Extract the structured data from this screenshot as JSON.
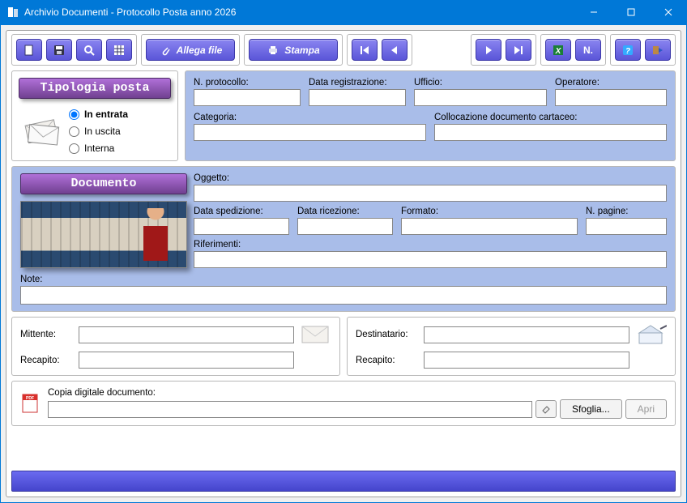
{
  "window": {
    "title": "Archivio Documenti - Protocollo Posta anno 2026"
  },
  "toolbar": {
    "new_icon": "new-file",
    "save_icon": "save",
    "search_icon": "search",
    "grid_icon": "grid",
    "attach_label": "Allega file",
    "print_label": "Stampa",
    "nav_first": "first",
    "nav_prev": "prev",
    "nav_next": "next",
    "nav_last": "last",
    "excel_icon": "excel",
    "n_label": "N.",
    "help_icon": "help",
    "exit_icon": "exit"
  },
  "type_panel": {
    "title": "Tipologia posta",
    "options": {
      "in_entrata": "In entrata",
      "in_uscita": "In uscita",
      "interna": "Interna"
    },
    "selected": "in_entrata"
  },
  "protocol": {
    "n_protocollo_label": "N. protocollo:",
    "n_protocollo": "",
    "data_registrazione_label": "Data registrazione:",
    "data_registrazione": "",
    "ufficio_label": "Ufficio:",
    "ufficio": "",
    "operatore_label": "Operatore:",
    "operatore": "",
    "categoria_label": "Categoria:",
    "categoria": "",
    "collocazione_label": "Collocazione documento cartaceo:",
    "collocazione": ""
  },
  "documento": {
    "title": "Documento",
    "oggetto_label": "Oggetto:",
    "oggetto": "",
    "data_spedizione_label": "Data spedizione:",
    "data_spedizione": "",
    "data_ricezione_label": "Data ricezione:",
    "data_ricezione": "",
    "formato_label": "Formato:",
    "formato": "",
    "n_pagine_label": "N. pagine:",
    "n_pagine": "",
    "riferimenti_label": "Riferimenti:",
    "riferimenti": "",
    "note_label": "Note:",
    "note": ""
  },
  "mittente": {
    "mittente_label": "Mittente:",
    "mittente": "",
    "recapito_label": "Recapito:",
    "recapito": ""
  },
  "destinatario": {
    "destinatario_label": "Destinatario:",
    "destinatario": "",
    "recapito_label": "Recapito:",
    "recapito": ""
  },
  "digital": {
    "label": "Copia digitale documento:",
    "path": "",
    "browse_label": "Sfoglia...",
    "open_label": "Apri"
  }
}
